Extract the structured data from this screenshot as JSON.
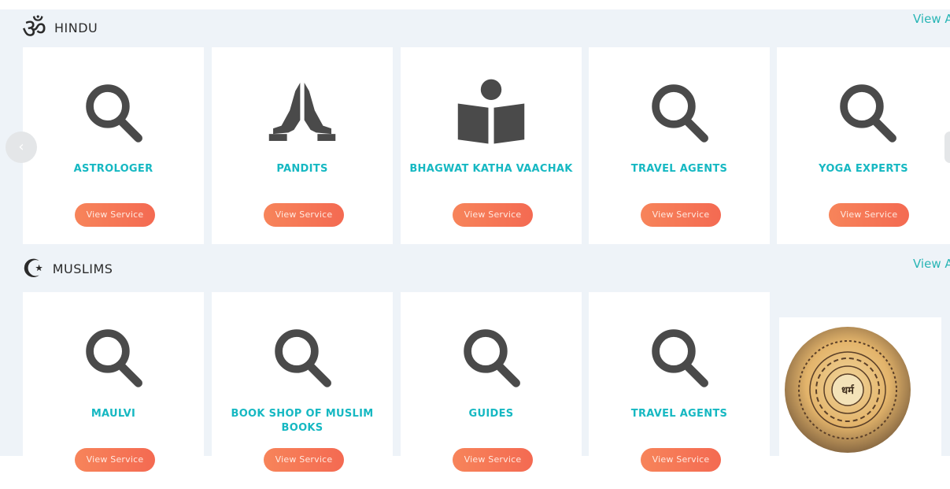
{
  "hindu": {
    "symbol": "ॐ",
    "title": "HINDU",
    "view_all": "View A",
    "cards": [
      {
        "label": "ASTROLOGER",
        "button": "View Service",
        "icon": "magnifier-icon"
      },
      {
        "label": "PANDITS",
        "button": "View Service",
        "icon": "praying-hands-icon"
      },
      {
        "label": "BHAGWAT KATHA VAACHAK",
        "button": "View Service",
        "icon": "reader-icon"
      },
      {
        "label": "TRAVEL AGENTS",
        "button": "View Service",
        "icon": "magnifier-icon"
      },
      {
        "label": "YOGA EXPERTS",
        "button": "View Service",
        "icon": "magnifier-icon"
      }
    ],
    "prev_arrow": "‹"
  },
  "muslims": {
    "symbol": "☪",
    "title": "MUSLIMS",
    "view_all": "View A",
    "cards": [
      {
        "label": "MAULVI",
        "button": "View Service",
        "icon": "magnifier-icon"
      },
      {
        "label": "BOOK SHOP OF MUSLIM BOOKS",
        "button": "View Service",
        "icon": "magnifier-icon"
      },
      {
        "label": "GUIDES",
        "button": "View Service",
        "icon": "magnifier-icon"
      },
      {
        "label": "TRAVEL AGENTS",
        "button": "View Service",
        "icon": "magnifier-icon"
      }
    ],
    "promo_logo_text": "धर्म"
  },
  "colors": {
    "accent_teal": "#16b8c2",
    "button_orange": "#f46a52",
    "icon_gray": "#4a4a4a",
    "section_bg": "#eef3f8"
  }
}
